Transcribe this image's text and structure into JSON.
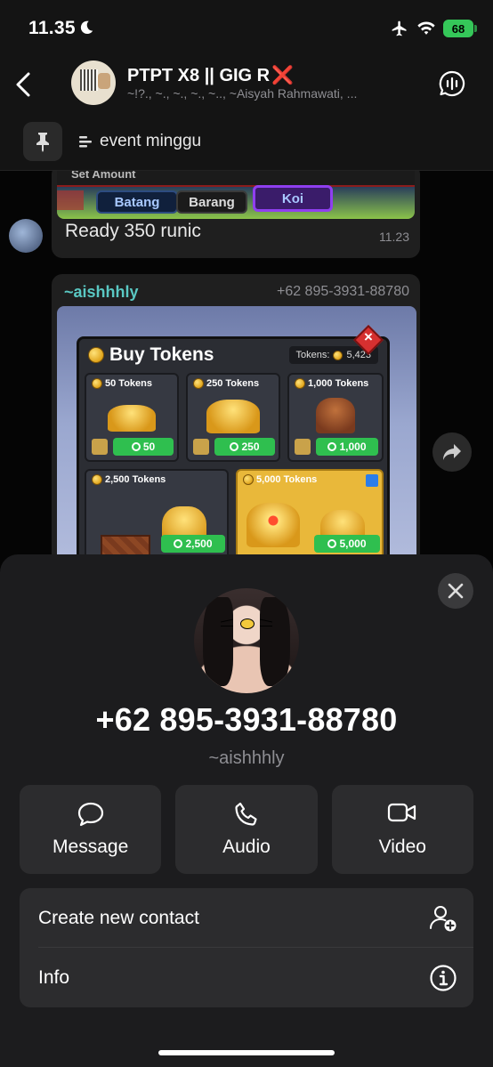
{
  "status_bar": {
    "time": "11.35",
    "battery": "68"
  },
  "chat": {
    "title": "PTPT X8 || GIG R",
    "title_mark": "❌",
    "subtitle": "~!?., ~., ~., ~., ~.., ~Aisyah Rahmawati, ..."
  },
  "pinned": {
    "text": "event minggu"
  },
  "messages": {
    "first": {
      "image_header": "Set Amount",
      "image_buttons": [
        "Batang",
        "Barang",
        "Koi"
      ],
      "text": "Ready 350 runic",
      "time": "11.23"
    },
    "second": {
      "sender": "~aishhhly",
      "phone": "+62 895-3931-88780",
      "shop": {
        "title": "Buy Tokens",
        "balance_label": "Tokens:",
        "balance": "5,423",
        "cards": [
          {
            "label": "50 Tokens",
            "price": "50"
          },
          {
            "label": "250 Tokens",
            "price": "250"
          },
          {
            "label": "1,000 Tokens",
            "price": "1,000"
          },
          {
            "label": "2,500 Tokens",
            "price": "2,500"
          },
          {
            "label": "5,000 Tokens",
            "price": "5,000"
          }
        ]
      }
    }
  },
  "contact_sheet": {
    "phone": "+62 895-3931-88780",
    "name": "~aishhhly",
    "actions": [
      {
        "label": "Message",
        "icon": "message-icon"
      },
      {
        "label": "Audio",
        "icon": "phone-icon"
      },
      {
        "label": "Video",
        "icon": "video-icon"
      }
    ],
    "rows": [
      {
        "label": "Create new contact",
        "icon": "add-contact-icon"
      },
      {
        "label": "Info",
        "icon": "info-icon"
      }
    ]
  },
  "colors": {
    "sheet_bg": "#1c1c1e",
    "card_bg": "#2c2c2e",
    "sender_name": "#5ac8c3",
    "battery": "#35c759"
  }
}
